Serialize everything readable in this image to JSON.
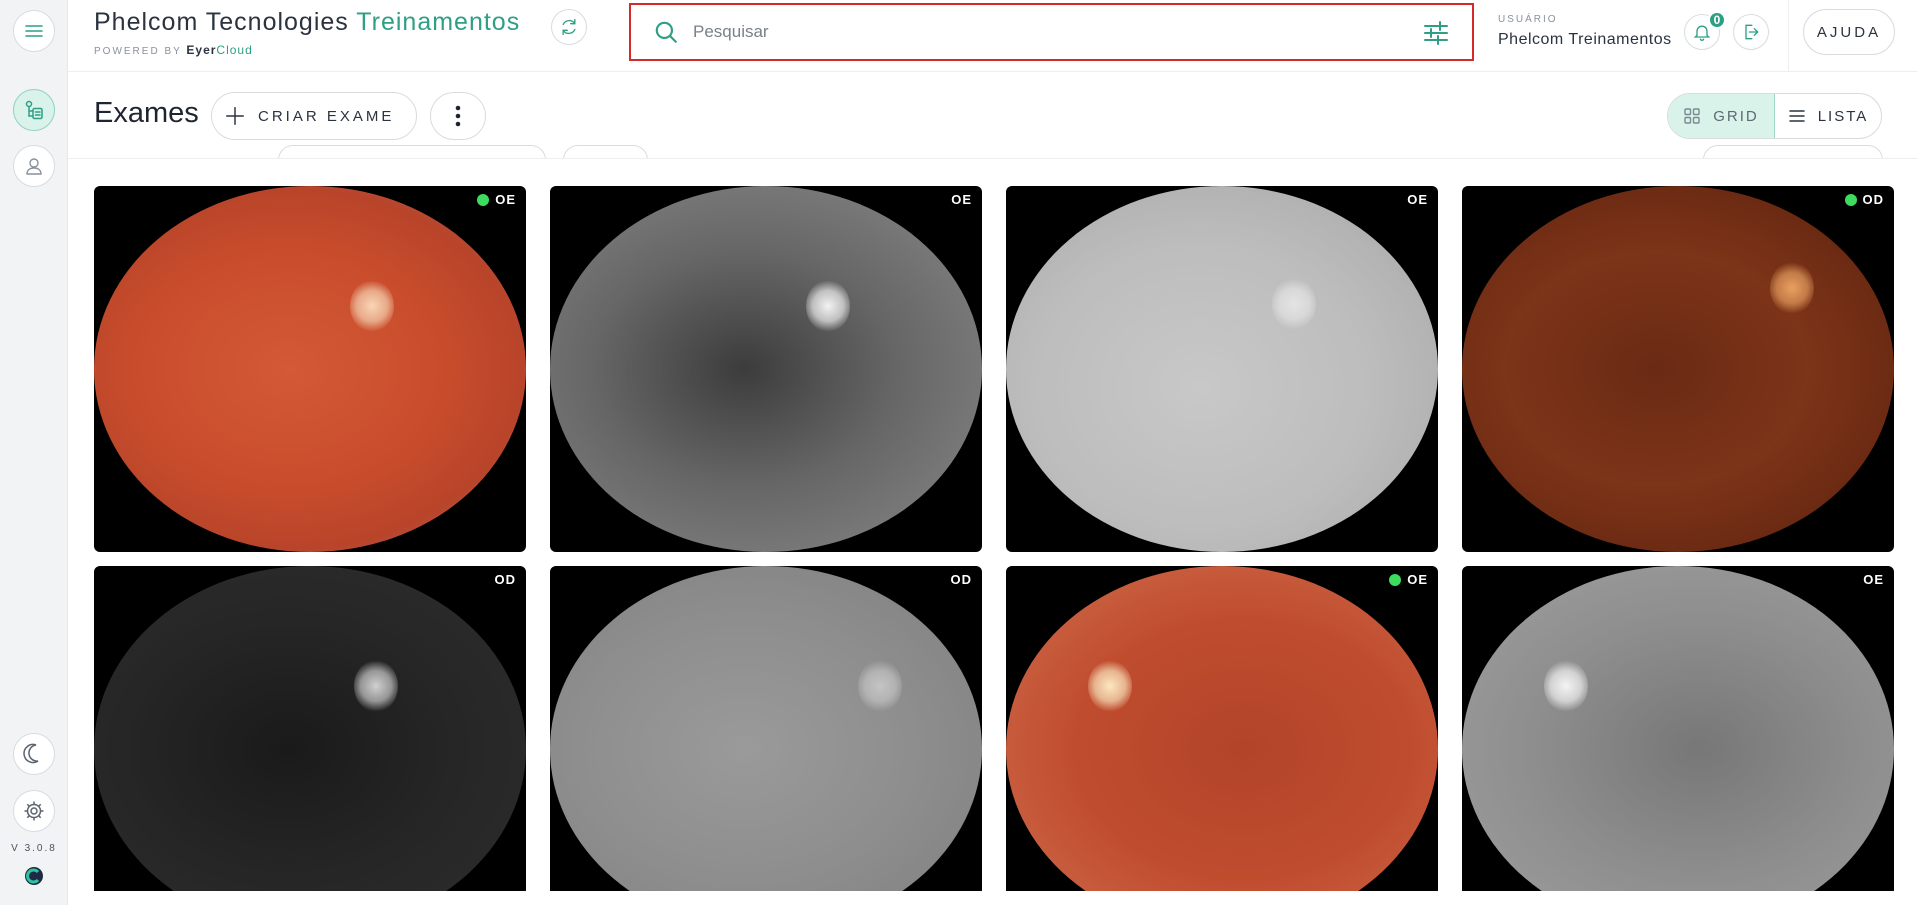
{
  "sidebar": {
    "version": "V 3.0.8"
  },
  "header": {
    "brand_main": "Phelcom Tecnologies",
    "brand_accent": "Treinamentos",
    "powered_by": "POWERED BY",
    "powered_brand": "Eyer",
    "powered_cloud": "Cloud",
    "search_placeholder": "Pesquisar",
    "user_label": "USUÁRIO",
    "user_name": "Phelcom Treinamentos",
    "notifications_count": "0",
    "help_label": "AJUDA"
  },
  "toolbar": {
    "title": "Exames",
    "create_label": "CRIAR EXAME",
    "view_grid": "GRID",
    "view_list": "LISTA",
    "active_view": "grid"
  },
  "colors": {
    "accent": "#2e9f85",
    "search_border": "#d62a2a",
    "status_dot": "#3ddb5e"
  },
  "exams": [
    {
      "eye": "OE",
      "status_dot": true,
      "tone": "color"
    },
    {
      "eye": "OE",
      "status_dot": false,
      "tone": "gray"
    },
    {
      "eye": "OE",
      "status_dot": false,
      "tone": "lightgray"
    },
    {
      "eye": "OD",
      "status_dot": true,
      "tone": "darkred"
    },
    {
      "eye": "OD",
      "status_dot": false,
      "tone": "dark"
    },
    {
      "eye": "OD",
      "status_dot": false,
      "tone": "midgray"
    },
    {
      "eye": "OE",
      "status_dot": true,
      "tone": "color2"
    },
    {
      "eye": "OE",
      "status_dot": false,
      "tone": "gray2"
    }
  ]
}
